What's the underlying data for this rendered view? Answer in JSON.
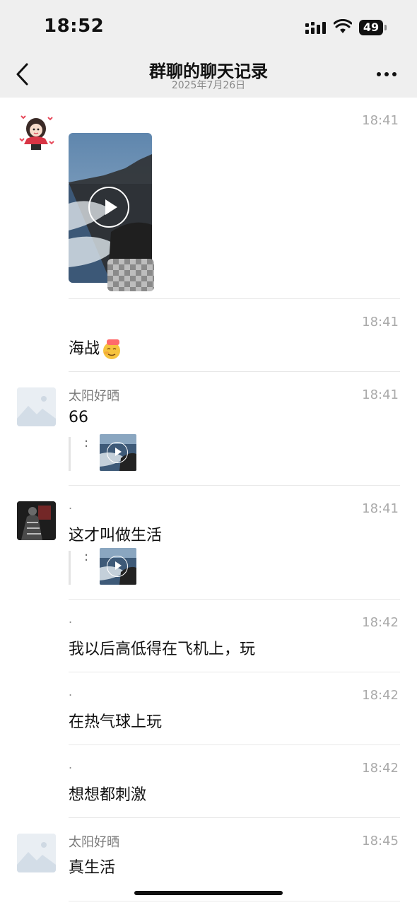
{
  "status_bar": {
    "time": "18:52",
    "battery": "49"
  },
  "nav": {
    "title": "群聊的聊天记录",
    "subtitle": "2025年7月26日"
  },
  "messages": [
    {
      "sender": "",
      "time": "18:41",
      "text": "",
      "attachment": "video"
    },
    {
      "sender": "",
      "time": "18:41",
      "text": "海战",
      "emoji": "666-emoji"
    },
    {
      "sender": "太阳好晒",
      "time": "18:41",
      "text": "66",
      "quote": ":"
    },
    {
      "sender": ".",
      "time": "18:41",
      "text": "这才叫做生活",
      "quote": ":"
    },
    {
      "sender": ".",
      "time": "18:42",
      "text": "我以后高低得在飞机上，玩"
    },
    {
      "sender": ".",
      "time": "18:42",
      "text": "在热气球上玩"
    },
    {
      "sender": ".",
      "time": "18:42",
      "text": "想想都刺激"
    },
    {
      "sender": "太阳好晒",
      "time": "18:45",
      "text": "真生活"
    }
  ],
  "icons": [
    "back-chevron-icon",
    "more-icon",
    "signal-icon",
    "wifi-icon",
    "battery-icon",
    "play-icon"
  ],
  "colors": {
    "header_bg": "#efefef",
    "timestamp": "#aaaaaa",
    "sender": "#7a7a7a",
    "divider": "#e8e8e8"
  }
}
